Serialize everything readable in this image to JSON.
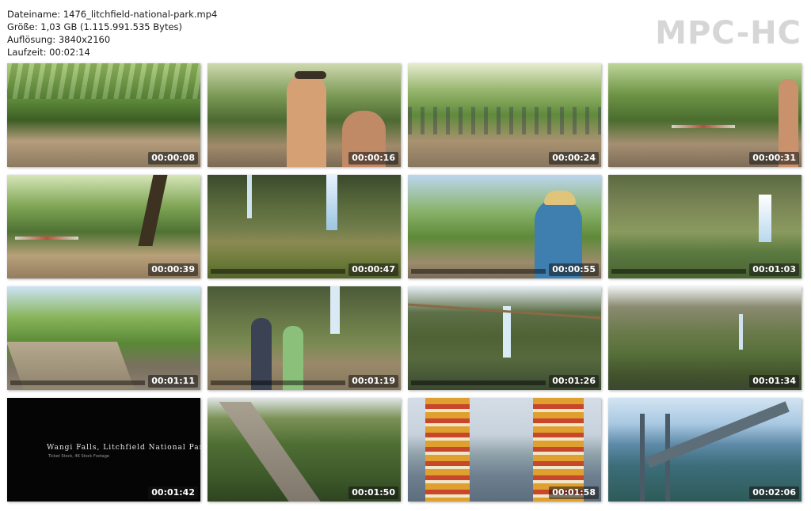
{
  "file_info": {
    "filename": "Dateiname: 1476_litchfield-national-park.mp4",
    "size": "Größe: 1,03 GB (1.115.991.535 Bytes)",
    "resolution": "Auflösung: 3840x2160",
    "duration": "Laufzeit: 00:02:14"
  },
  "brand": "MPC-HC",
  "thumbnails": [
    {
      "timestamp": "00:00:08",
      "scene": "forest-picnic"
    },
    {
      "timestamp": "00:00:16",
      "scene": "swimmers-hat"
    },
    {
      "timestamp": "00:00:24",
      "scene": "forest-crowd"
    },
    {
      "timestamp": "00:00:31",
      "scene": "forest-shade"
    },
    {
      "timestamp": "00:00:39",
      "scene": "forest-clearing"
    },
    {
      "timestamp": "00:00:47",
      "scene": "waterfall-pool"
    },
    {
      "timestamp": "00:00:55",
      "scene": "woman-hat-waterfall"
    },
    {
      "timestamp": "00:01:03",
      "scene": "waterfall-cliff"
    },
    {
      "timestamp": "00:01:11",
      "scene": "boardwalk"
    },
    {
      "timestamp": "00:01:19",
      "scene": "viewing-platform"
    },
    {
      "timestamp": "00:01:26",
      "scene": "waterfall-wide"
    },
    {
      "timestamp": "00:01:34",
      "scene": "cliff-lake"
    },
    {
      "timestamp": "00:01:42",
      "scene": "title-card"
    },
    {
      "timestamp": "00:01:50",
      "scene": "great-wall"
    },
    {
      "timestamp": "00:01:58",
      "scene": "pagodas"
    },
    {
      "timestamp": "00:02:06",
      "scene": "bridge-aerial"
    }
  ],
  "title_card": {
    "title": "Wangi Falls, Litchfield National Park",
    "subtitle": "Ticket Stock, 4K Stock Footage"
  }
}
